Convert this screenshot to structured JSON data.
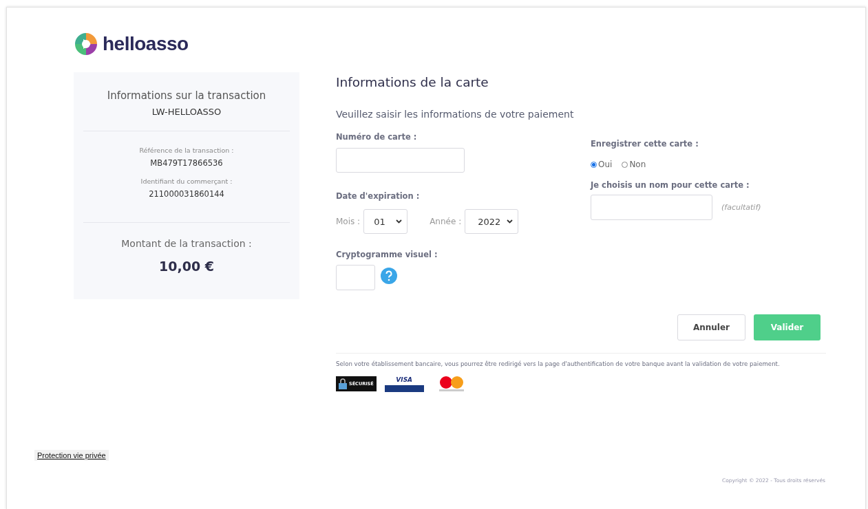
{
  "brand": {
    "name": "helloasso"
  },
  "summary": {
    "title": "Informations sur la transaction",
    "merchant_name": "LW-HELLOASSO",
    "details": [
      {
        "label": "Référence de la transaction :",
        "value": "MB479T17866536"
      },
      {
        "label": "Identifiant du commerçant :",
        "value": "211000031860144"
      }
    ],
    "amount_label": "Montant de la transaction :",
    "amount": "10,00 €"
  },
  "form": {
    "title": "Informations de la carte",
    "subtitle": "Veuillez saisir les informations de votre paiement",
    "card_number_label": "Numéro de carte :",
    "expiry_label": "Date d'expiration :",
    "month": {
      "label": "Mois :",
      "value": "01"
    },
    "year": {
      "label": "Année :",
      "value": "2022"
    },
    "cvv_label": "Cryptogramme visuel :",
    "save_label": "Enregistrer cette carte :",
    "save_options": [
      {
        "label": "Oui",
        "selected": true
      },
      {
        "label": "Non",
        "selected": false
      }
    ],
    "card_name_label": "Je choisis un nom pour cette carte :",
    "card_name_hint": "(facultatif)",
    "buttons": [
      {
        "label": "Annuler",
        "kind": "secondary"
      },
      {
        "label": "Valider",
        "kind": "primary"
      }
    ],
    "notice": "Selon votre établissement bancaire, vous pourrez être redirigé vers la page d'authentification de votre banque avant la validation de votre paiement.",
    "badges": [
      {
        "kind": "secure",
        "text": "SÉCURISÉ"
      },
      {
        "kind": "visa",
        "text": "VISA"
      },
      {
        "kind": "mastercard"
      }
    ]
  },
  "privacy_link": "Protection vie privée",
  "copyright": "Copyright © 2022 - Tous droits réservés"
}
